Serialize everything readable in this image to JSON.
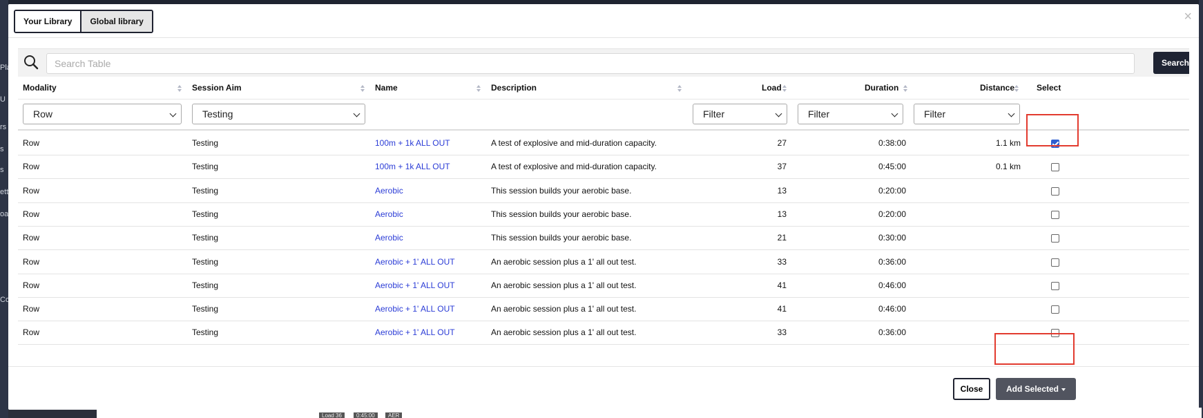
{
  "tabs": [
    {
      "label": "Your Library",
      "active": false
    },
    {
      "label": "Global library",
      "active": true
    }
  ],
  "modal_close": "×",
  "search": {
    "placeholder": "Search Table",
    "value": "",
    "button": "Search"
  },
  "columns": {
    "modality": "Modality",
    "session_aim": "Session Aim",
    "name": "Name",
    "description": "Description",
    "load": "Load",
    "duration": "Duration",
    "distance": "Distance",
    "select": "Select"
  },
  "filters": {
    "modality": "Row",
    "session_aim": "Testing",
    "load": "Filter",
    "duration": "Filter",
    "distance": "Filter"
  },
  "rows": [
    {
      "modality": "Row",
      "aim": "Testing",
      "name": "100m + 1k ALL OUT",
      "description": "A test of explosive and mid-duration capacity.",
      "load": "27",
      "duration": "0:38:00",
      "distance": "1.1 km",
      "selected": true
    },
    {
      "modality": "Row",
      "aim": "Testing",
      "name": "100m + 1k ALL OUT",
      "description": "A test of explosive and mid-duration capacity.",
      "load": "37",
      "duration": "0:45:00",
      "distance": "0.1 km",
      "selected": false
    },
    {
      "modality": "Row",
      "aim": "Testing",
      "name": "Aerobic",
      "description": "This session builds your aerobic base.",
      "load": "13",
      "duration": "0:20:00",
      "distance": "",
      "selected": false
    },
    {
      "modality": "Row",
      "aim": "Testing",
      "name": "Aerobic",
      "description": "This session builds your aerobic base.",
      "load": "13",
      "duration": "0:20:00",
      "distance": "",
      "selected": false
    },
    {
      "modality": "Row",
      "aim": "Testing",
      "name": "Aerobic",
      "description": "This session builds your aerobic base.",
      "load": "21",
      "duration": "0:30:00",
      "distance": "",
      "selected": false
    },
    {
      "modality": "Row",
      "aim": "Testing",
      "name": "Aerobic + 1' ALL OUT",
      "description": "An aerobic session plus a 1' all out test.",
      "load": "33",
      "duration": "0:36:00",
      "distance": "",
      "selected": false
    },
    {
      "modality": "Row",
      "aim": "Testing",
      "name": "Aerobic + 1' ALL OUT",
      "description": "An aerobic session plus a 1' all out test.",
      "load": "41",
      "duration": "0:46:00",
      "distance": "",
      "selected": false
    },
    {
      "modality": "Row",
      "aim": "Testing",
      "name": "Aerobic + 1' ALL OUT",
      "description": "An aerobic session plus a 1' all out test.",
      "load": "41",
      "duration": "0:46:00",
      "distance": "",
      "selected": false
    },
    {
      "modality": "Row",
      "aim": "Testing",
      "name": "Aerobic + 1' ALL OUT",
      "description": "An aerobic session plus a 1' all out test.",
      "load": "33",
      "duration": "0:36:00",
      "distance": "",
      "selected": false
    }
  ],
  "footer": {
    "close": "Close",
    "add_selected": "Add Selected"
  },
  "background": {
    "side_fragments": [
      "Pla",
      "U",
      "rs",
      "s",
      "s",
      "etti",
      "oa",
      "Co"
    ],
    "bottom_chips": [
      "Load 36",
      "0:45:00",
      "AER"
    ]
  },
  "colors": {
    "accent": "#1f2433",
    "link": "#2a3bd6",
    "highlight": "#e23a2e",
    "checkbox": "#2f5fd0"
  }
}
